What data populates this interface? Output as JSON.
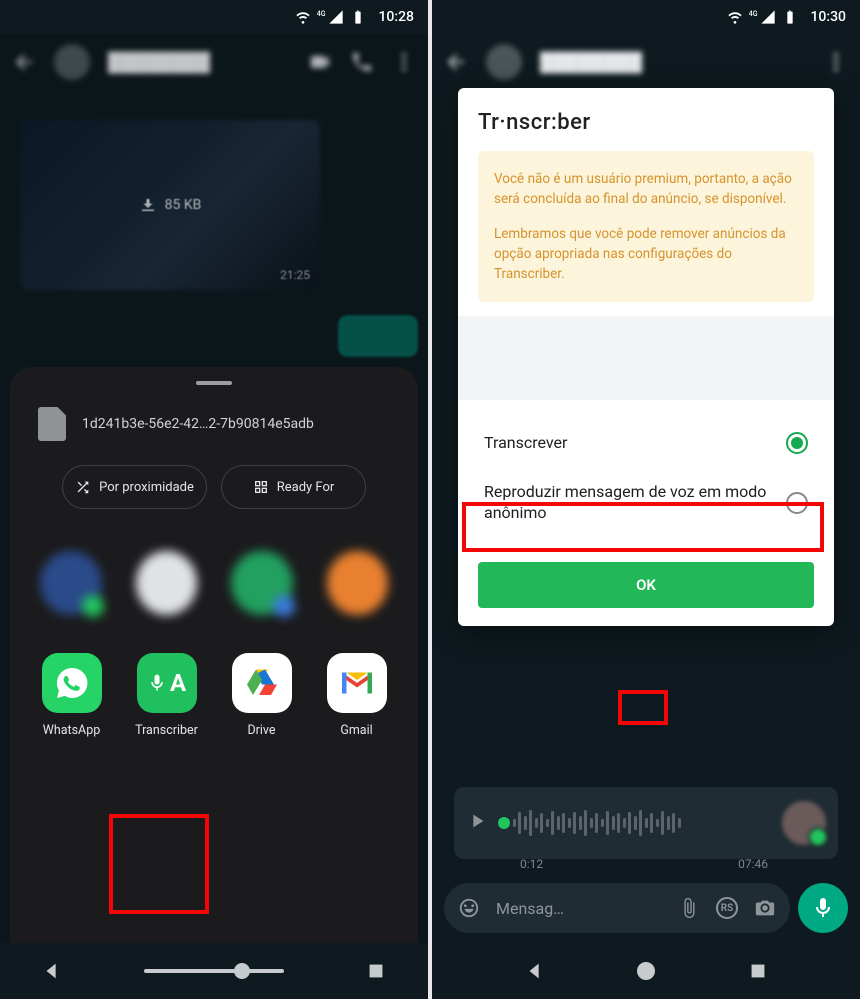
{
  "left": {
    "status": {
      "network": "4G",
      "time": "10:28"
    },
    "image": {
      "size": "85 KB",
      "time": "21:25"
    },
    "file": {
      "name": "1d241b3e-56e2-42…2-7b90814e5adb"
    },
    "pills": {
      "proximity": "Por proximidade",
      "readyfor": "Ready For"
    },
    "apps": {
      "whatsapp": "WhatsApp",
      "transcriber": "Transcriber",
      "drive": "Drive",
      "gmail": "Gmail"
    }
  },
  "right": {
    "status": {
      "network": "4G",
      "time": "10:30"
    },
    "dialog": {
      "title": "Tr·nscr:ber",
      "premium_p1": "Você não é um usuário premium, portanto, a ação será concluída ao final do anúncio, se disponível.",
      "premium_p2": "Lembramos que você pode remover anúncios da opção apropriada nas configurações do Transcriber.",
      "option_transcrever": "Transcrever",
      "option_reproduzir": "Reproduzir mensagem de voz em modo anônimo",
      "ok": "OK"
    },
    "voice": {
      "t_start": "0:12",
      "t_end": "07:46"
    },
    "input": {
      "placeholder": "Mensag…",
      "currency": "RS"
    }
  }
}
